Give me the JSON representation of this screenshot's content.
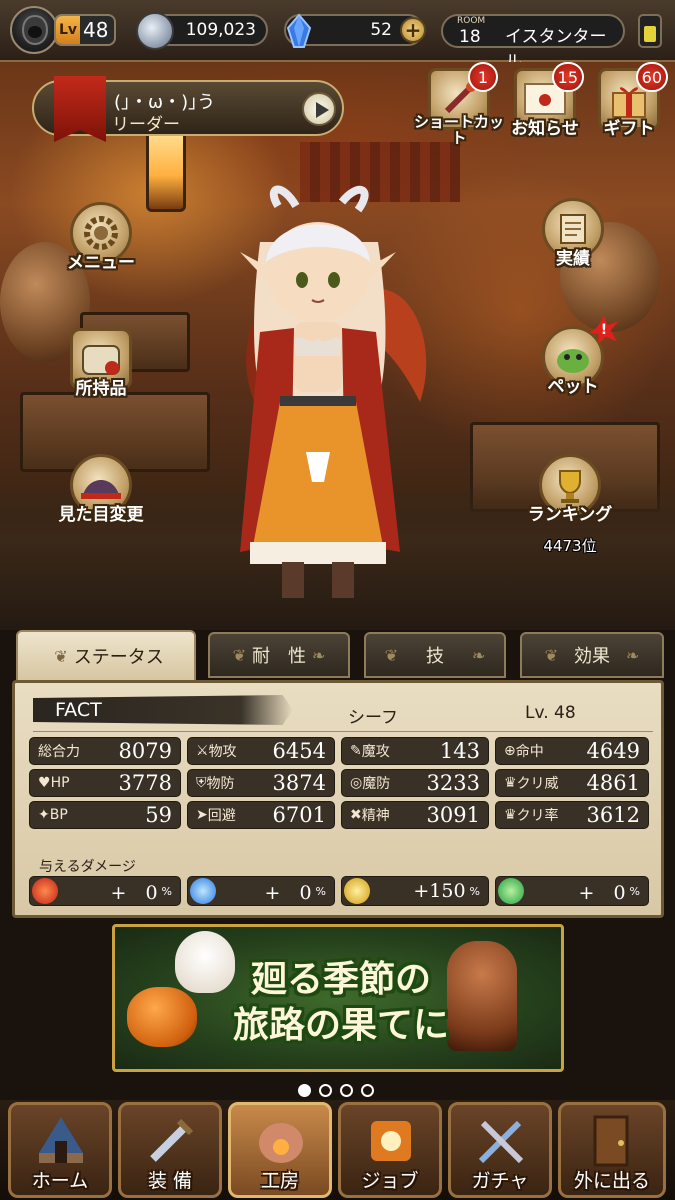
{
  "topbar": {
    "level_tag": "Lv",
    "level": "48",
    "gil": "109,023",
    "crystals": "52",
    "room_label": "ROOM",
    "room_number": "18",
    "room_name": "イスタンタール"
  },
  "leader": {
    "name": "(｣・ω・)｣う",
    "label": "リーダー"
  },
  "hud": {
    "shortcut": {
      "label": "ショートカット",
      "badge": "1"
    },
    "news": {
      "label": "お知らせ",
      "badge": "15"
    },
    "gift": {
      "label": "ギフト",
      "badge": "60"
    },
    "menu": {
      "label": "メニュー"
    },
    "items": {
      "label": "所持品"
    },
    "appearance": {
      "label": "見た目変更"
    },
    "achievements": {
      "label": "実績"
    },
    "pet": {
      "label": "ペット",
      "alert": "!"
    },
    "ranking": {
      "label": "ランキング",
      "rank": "4473位"
    }
  },
  "tabs": [
    {
      "label": "ステータス",
      "active": true
    },
    {
      "label": "耐　性"
    },
    {
      "label": "技"
    },
    {
      "label": "効果"
    }
  ],
  "status": {
    "char_name": "FACT",
    "job": "シーフ",
    "level": "Lv. 48",
    "stats": [
      {
        "label": "総合力",
        "value": "8079"
      },
      {
        "label": "物攻",
        "value": "6454",
        "icon": "sword-icon"
      },
      {
        "label": "魔攻",
        "value": "143",
        "icon": "staff-icon"
      },
      {
        "label": "命中",
        "value": "4649",
        "icon": "target-icon"
      },
      {
        "label": "HP",
        "value": "3778",
        "icon": "heart-icon"
      },
      {
        "label": "物防",
        "value": "3874",
        "icon": "shield-icon"
      },
      {
        "label": "魔防",
        "value": "3233",
        "icon": "magic-shield-icon"
      },
      {
        "label": "クリ威",
        "value": "4861",
        "icon": "crown-icon"
      },
      {
        "label": "BP",
        "value": "59",
        "icon": "diamond-icon"
      },
      {
        "label": "回避",
        "value": "6701",
        "icon": "boot-icon"
      },
      {
        "label": "精神",
        "value": "3091",
        "icon": "cross-icon"
      },
      {
        "label": "クリ率",
        "value": "3612",
        "icon": "crown-icon"
      }
    ],
    "damage_title": "与えるダメージ",
    "damage": [
      {
        "element": "fire",
        "value": "+　0",
        "unit": "%",
        "color": "#d0281a"
      },
      {
        "element": "ice",
        "value": "+　0",
        "unit": "%",
        "color": "#2a7ae0"
      },
      {
        "element": "lightning",
        "value": "+150",
        "unit": "%",
        "color": "#e0a81a"
      },
      {
        "element": "wind",
        "value": "+　0",
        "unit": "%",
        "color": "#2ab04a"
      }
    ]
  },
  "banner": {
    "line1": "廻る季節の",
    "line2": "旅路の果てに"
  },
  "nav": [
    {
      "label": "ホーム"
    },
    {
      "label": "装 備"
    },
    {
      "label": "工房",
      "active": true
    },
    {
      "label": "ジョブ"
    },
    {
      "label": "ガチャ"
    },
    {
      "label": "外に出る"
    }
  ]
}
